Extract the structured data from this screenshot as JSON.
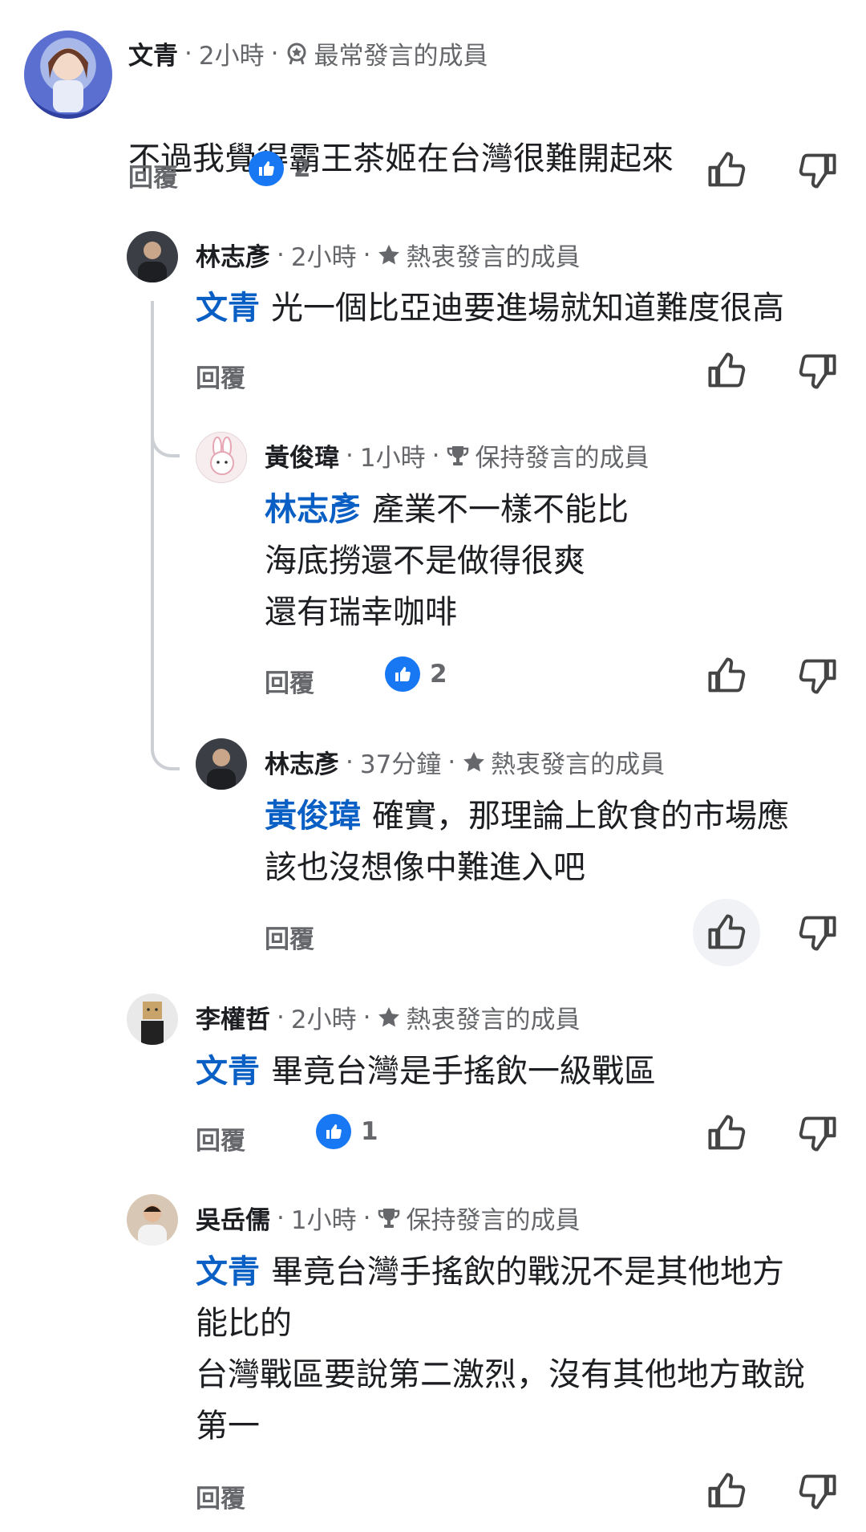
{
  "reply_label": "回覆",
  "comments": [
    {
      "author": "文青",
      "time": "2小時",
      "badge": "最常發言的成員",
      "badge_icon": "medal-icon",
      "mention": "",
      "lines": [
        "不過我覺得霸王茶姬在台灣很難開起來"
      ],
      "like_count": "2"
    },
    {
      "author": "林志彥",
      "time": "2小時",
      "badge": "熱衷發言的成員",
      "badge_icon": "star-icon",
      "mention": "文青",
      "lines": [
        "光一個比亞迪要進場就知道難度很高"
      ],
      "like_count": ""
    },
    {
      "author": "黃俊瑋",
      "time": "1小時",
      "badge": "保持發言的成員",
      "badge_icon": "trophy-icon",
      "mention": "林志彥",
      "lines": [
        "產業不一樣不能比",
        "海底撈還不是做得很爽",
        "還有瑞幸咖啡"
      ],
      "like_count": "2"
    },
    {
      "author": "林志彥",
      "time": "37分鐘",
      "badge": "熱衷發言的成員",
      "badge_icon": "star-icon",
      "mention": "黃俊瑋",
      "lines": [
        "確實，那理論上飲食的市場應",
        "該也沒想像中難進入吧"
      ],
      "like_count": ""
    },
    {
      "author": "李權哲",
      "time": "2小時",
      "badge": "熱衷發言的成員",
      "badge_icon": "star-icon",
      "mention": "文青",
      "lines": [
        "畢竟台灣是手搖飲一級戰區"
      ],
      "like_count": "1"
    },
    {
      "author": "吳岳儒",
      "time": "1小時",
      "badge": "保持發言的成員",
      "badge_icon": "trophy-icon",
      "mention": "文青",
      "lines": [
        "畢竟台灣手搖飲的戰況不是其他地方",
        "能比的",
        "台灣戰區要說第二激烈，沒有其他地方敢說",
        "第一"
      ],
      "like_count": ""
    }
  ],
  "colors": {
    "mention": "#0a5fc4",
    "like_blue": "#1877f2",
    "meta_gray": "#65676b",
    "thread_line": "#ccd0d5"
  }
}
